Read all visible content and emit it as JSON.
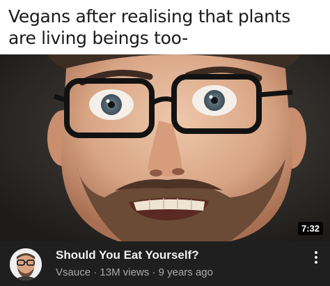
{
  "meme": {
    "caption": "Vegans after realising that plants are living beings too-"
  },
  "video": {
    "duration": "7:32",
    "title": "Should You Eat Yourself?",
    "channel": "Vsauce",
    "views": "13M views",
    "age": "9 years ago",
    "separator": "·",
    "more_icon": "vertical-ellipsis-icon"
  }
}
